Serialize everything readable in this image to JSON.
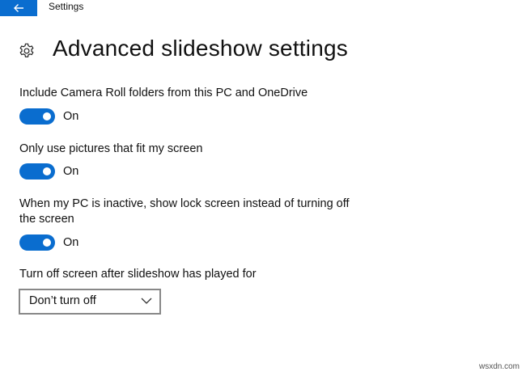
{
  "window": {
    "title": "Settings",
    "back_icon": "arrow-left-icon",
    "accent": "#0a6dcf"
  },
  "page": {
    "icon": "gear-icon",
    "title": "Advanced slideshow settings"
  },
  "settings": [
    {
      "label": "Include Camera Roll folders from this PC and OneDrive",
      "state": "On",
      "on": true
    },
    {
      "label": "Only use pictures that fit my screen",
      "state": "On",
      "on": true
    },
    {
      "label_line1": "When my PC is inactive, show lock screen instead of turning off",
      "label_line2": "the screen",
      "state": "On",
      "on": true
    }
  ],
  "turn_off": {
    "label": "Turn off screen after slideshow has played for",
    "selected": "Don’t turn off",
    "chevron_icon": "chevron-down-icon"
  },
  "watermark": "wsxdn.com"
}
